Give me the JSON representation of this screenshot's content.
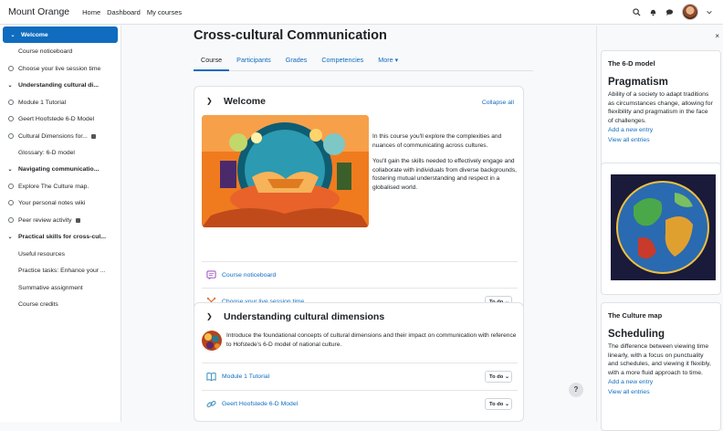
{
  "navbar": {
    "brand": "Mount Orange",
    "links": [
      "Home",
      "Dashboard",
      "My courses"
    ]
  },
  "left_drawer": {
    "close": "×",
    "menu": "⋮",
    "items": [
      {
        "label": "Welcome",
        "type": "section",
        "active": true
      },
      {
        "label": "Course noticeboard",
        "type": "plain"
      },
      {
        "label": "Choose your live session time",
        "type": "activity"
      },
      {
        "label": "Understanding cultural di...",
        "type": "section"
      },
      {
        "label": "Module 1 Tutorial",
        "type": "activity"
      },
      {
        "label": "Geert Hoofstede 6-D Model",
        "type": "activity"
      },
      {
        "label": "Cultural Dimensions for...",
        "type": "activity",
        "locked": true
      },
      {
        "label": "Glossary: 6-D model",
        "type": "plain"
      },
      {
        "label": "Navigating communicatio...",
        "type": "section"
      },
      {
        "label": "Explore The Culture map.",
        "type": "activity"
      },
      {
        "label": "Your personal notes wiki",
        "type": "activity"
      },
      {
        "label": "Peer review activity",
        "type": "activity",
        "locked": true
      },
      {
        "label": "Practical skills for cross-cul...",
        "type": "section"
      },
      {
        "label": "Useful resources",
        "type": "plain"
      },
      {
        "label": "Practice tasks: Enhance your ...",
        "type": "plain"
      },
      {
        "label": "Summative assignment",
        "type": "plain"
      },
      {
        "label": "Course credits",
        "type": "plain"
      }
    ]
  },
  "course": {
    "title": "Cross-cultural Communication",
    "tabs": [
      "Course",
      "Participants",
      "Grades",
      "Competencies",
      "More"
    ],
    "welcome": {
      "title": "Welcome",
      "collapse_all": "Collapse all",
      "para1": "In this course you'll explore the complexities and nuances of communicating across cultures.",
      "para2": "You'll gain the skills needed to effectively engage and collaborate with individuals from diverse backgrounds, fostering mutual understanding and respect in a globalised world.",
      "activities": [
        {
          "name": "Course noticeboard",
          "icon": "forum-icon"
        },
        {
          "name": "Choose your live session time",
          "icon": "choice-icon",
          "todo": "To do"
        }
      ]
    },
    "dimensions": {
      "title": "Understanding cultural dimensions",
      "intro": "Introduce the foundational concepts of cultural dimensions and their impact on communication with reference to Hofstede's 6-D model of national culture.",
      "activities": [
        {
          "name": "Module 1 Tutorial",
          "icon": "book-icon",
          "todo": "To do"
        },
        {
          "name": "Geert Hoofstede 6-D Model",
          "icon": "link-icon",
          "todo": "To do"
        }
      ]
    }
  },
  "right_drawer": {
    "close": "×",
    "block1": {
      "title": "The 6-D model",
      "heading": "Pragmatism",
      "desc": "Ability of a society to adapt traditions as circumstances change, allowing for flexibility and pragmatism in the face of challenges.",
      "add": "Add a new entry",
      "view": "View all entries"
    },
    "block3": {
      "title": "The Culture map",
      "heading": "Scheduling",
      "desc": "The difference between viewing time linearly, with a focus on punctuality and schedules, and viewing it flexibly, with a more fluid approach to time.",
      "add": "Add a new entry",
      "view": "View all entries"
    }
  },
  "help": "?",
  "colors": {
    "accent": "#0f6cbf",
    "text": "#1d2125",
    "orange": "#f07b1f"
  }
}
